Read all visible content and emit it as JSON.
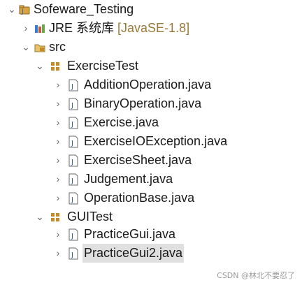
{
  "project": {
    "name": "Sofeware_Testing"
  },
  "library": {
    "name": "JRE 系统库",
    "decoration": "[JavaSE-1.8]"
  },
  "source_folder": {
    "name": "src"
  },
  "packages": [
    {
      "name": "ExerciseTest",
      "files": [
        "AdditionOperation.java",
        "BinaryOperation.java",
        "Exercise.java",
        "ExerciseIOException.java",
        "ExerciseSheet.java",
        "Judgement.java",
        "OperationBase.java"
      ]
    },
    {
      "name": "GUITest",
      "files": [
        "PracticeGui.java",
        "PracticeGui2.java"
      ]
    }
  ],
  "selected_file": "PracticeGui2.java",
  "watermark": "CSDN @林北不要忍了",
  "colors": {
    "selection": "#e0e0e0",
    "decoration": "#9a7a3a",
    "package": "#c48a2a",
    "java_file": "#2b5ea8"
  }
}
